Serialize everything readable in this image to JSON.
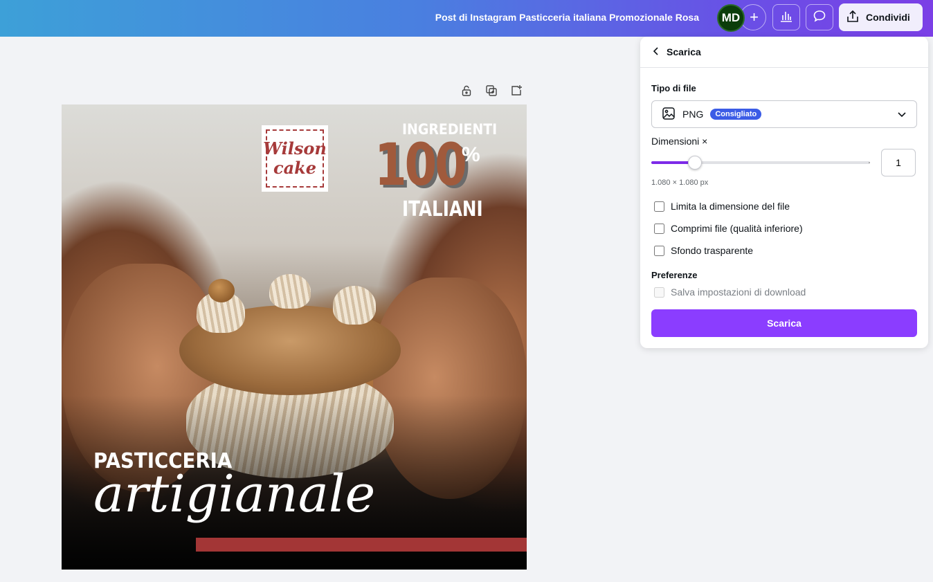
{
  "topbar": {
    "doc_title": "Post di Instagram Pasticceria italiana Promozionale Rosa",
    "avatar_initials": "MD",
    "add_label": "+",
    "share_label": "Condividi"
  },
  "design": {
    "logo_line1": "Wilson",
    "logo_line2": "cake",
    "ing_top": "INGREDIENTI",
    "big_number": "100",
    "percent": "%",
    "ing_bottom": "ITALIANI",
    "headline": "PASTICCERIA",
    "script_text": "artigianale",
    "accent_color": "#a33636"
  },
  "panel": {
    "title": "Scarica",
    "file_type_label": "Tipo di file",
    "file_type_value": "PNG",
    "recommended_badge": "Consigliato",
    "dimensions_label": "Dimensioni ×",
    "scale_value": "1",
    "scale_fraction": 0.2,
    "pixel_size": "1.080 × 1.080 px",
    "options": [
      {
        "label": "Limita la dimensione del file",
        "checked": false
      },
      {
        "label": "Comprimi file (qualità inferiore)",
        "checked": false
      },
      {
        "label": "Sfondo trasparente",
        "checked": false
      }
    ],
    "preferences_label": "Preferenze",
    "save_settings_label": "Salva impostazioni di download",
    "download_button": "Scarica",
    "accent_color": "#8b3dff"
  }
}
